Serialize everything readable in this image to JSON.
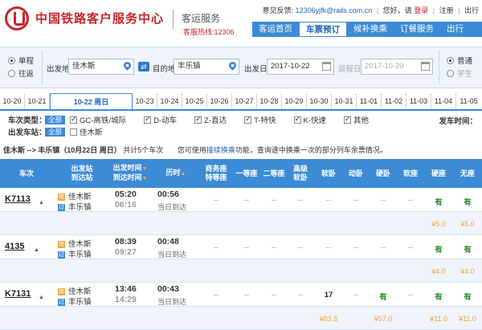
{
  "header": {
    "brand": "中国铁路客户服务中心",
    "subtitle": "客运服务",
    "hotline": "客服热线:12306",
    "feedback_label": "意见反馈:",
    "feedback_email": "12306yjfk@rails.com.cn",
    "greeting": "您好，请",
    "login": "登录",
    "register": "注册",
    "exit": "出行",
    "nav": [
      "客运首页",
      "车票预订",
      "候补换乘",
      "订餐服务",
      "出行"
    ]
  },
  "search": {
    "trip_types": [
      "单程",
      "往返"
    ],
    "from_label": "出发地",
    "from_value": "佳木斯",
    "to_label": "目的地",
    "to_value": "丰乐镇",
    "date_label": "出发日",
    "date_value": "2017-10-22",
    "return_label": "返程日",
    "return_value": "2017-10-20",
    "classes": [
      "普通",
      "学生"
    ]
  },
  "dates": [
    "10-20",
    "10-21",
    "10-22 周日",
    "10-23",
    "10-24",
    "10-25",
    "10-26",
    "10-27",
    "10-28",
    "10-29",
    "10-30",
    "10-31",
    "11-01",
    "11-02",
    "11-03",
    "11-04",
    "11-05"
  ],
  "filters": {
    "type_label": "车次类型：",
    "all": "全部",
    "types": [
      "GC-高铁/城际",
      "D-动车",
      "Z-直达",
      "T-特快",
      "K-快速",
      "其他"
    ],
    "station_label": "出发车站：",
    "stations": [
      "佳木斯"
    ],
    "dep_time_label": "发车时间："
  },
  "summary": {
    "route": "佳木斯 --> 丰乐镇（10月22日  周日）",
    "count": "共计5个车次",
    "hint_pre": "您可使用",
    "hint_link": "接续换乘",
    "hint_post": "功能，查询途中换乘一次的部分列车余票情况。"
  },
  "columns": {
    "train": "车次",
    "stations": [
      "出发站",
      "到达站"
    ],
    "times": [
      "出发时间",
      "到达时间"
    ],
    "duration": "历时",
    "business": [
      "商务座",
      "特等座"
    ],
    "first": "一等座",
    "second": "二等座",
    "soft_premium": [
      "高级",
      "软卧"
    ],
    "soft_sleeper": "软卧",
    "dong_sleeper": "动卧",
    "hard_sleeper": "硬卧",
    "soft_seat": "软座",
    "hard_seat": "硬座",
    "no_seat": "无座"
  },
  "trains": [
    {
      "no": "K7113",
      "from": "佳木斯",
      "to": "丰乐镇",
      "dep": "05:20",
      "arr": "06:16",
      "dur": "00:56",
      "arrive_note": "当日到达",
      "seats": [
        "--",
        "--",
        "--",
        "--",
        "--",
        "--",
        "--",
        "--",
        "有",
        "有"
      ],
      "prices": [
        "",
        "",
        "",
        "",
        "",
        "",
        "",
        "",
        "¥5.0",
        "¥5.0"
      ]
    },
    {
      "no": "4135",
      "from": "佳木斯",
      "to": "丰乐镇",
      "dep": "08:39",
      "arr": "09:27",
      "dur": "00:48",
      "arrive_note": "当日到达",
      "seats": [
        "--",
        "--",
        "--",
        "--",
        "--",
        "--",
        "--",
        "--",
        "有",
        "有"
      ],
      "prices": [
        "",
        "",
        "",
        "",
        "",
        "",
        "",
        "",
        "¥4.0",
        "¥4.0"
      ]
    },
    {
      "no": "K7131",
      "from": "佳木斯",
      "to": "丰乐镇",
      "dep": "13:46",
      "arr": "14:29",
      "dur": "00:43",
      "arrive_note": "当日到达",
      "seats": [
        "--",
        "--",
        "--",
        "--",
        "17",
        "--",
        "有",
        "--",
        "有",
        "有"
      ],
      "prices": [
        "",
        "",
        "",
        "",
        "¥83.5",
        "",
        "¥57.0",
        "",
        "¥11.0",
        "¥11.0"
      ]
    }
  ]
}
